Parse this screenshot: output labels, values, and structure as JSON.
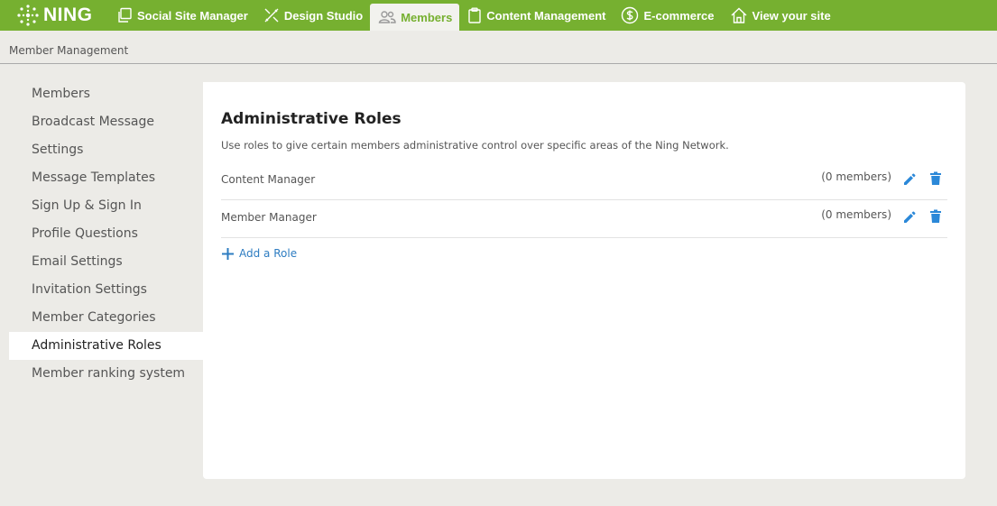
{
  "brand": {
    "name": "NING"
  },
  "nav": [
    {
      "label": "Social Site Manager",
      "icon": "pages-icon"
    },
    {
      "label": "Design Studio",
      "icon": "design-tools-icon"
    },
    {
      "label": "Members",
      "icon": "members-icon",
      "active": true
    },
    {
      "label": "Content Management",
      "icon": "clipboard-icon"
    },
    {
      "label": "E-commerce",
      "icon": "dollar-icon"
    },
    {
      "label": "View your site",
      "icon": "home-icon"
    }
  ],
  "breadcrumb": "Member Management",
  "sidebar": {
    "items": [
      {
        "label": "Members"
      },
      {
        "label": "Broadcast Message"
      },
      {
        "label": "Settings"
      },
      {
        "label": "Message Templates"
      },
      {
        "label": "Sign Up & Sign In"
      },
      {
        "label": "Profile Questions"
      },
      {
        "label": "Email Settings"
      },
      {
        "label": "Invitation Settings"
      },
      {
        "label": "Member Categories"
      },
      {
        "label": "Administrative Roles",
        "active": true
      },
      {
        "label": "Member ranking system"
      }
    ]
  },
  "main": {
    "title": "Administrative Roles",
    "description": "Use roles to give certain members administrative control over specific areas of the Ning Network.",
    "roles": [
      {
        "name": "Content Manager",
        "count": "(0 members)"
      },
      {
        "name": "Member Manager",
        "count": "(0 members)"
      }
    ],
    "add_role_label": "Add a Role"
  },
  "colors": {
    "brand_green": "#76b030",
    "link_blue": "#2d7cc1",
    "icon_blue": "#2b88d8"
  }
}
